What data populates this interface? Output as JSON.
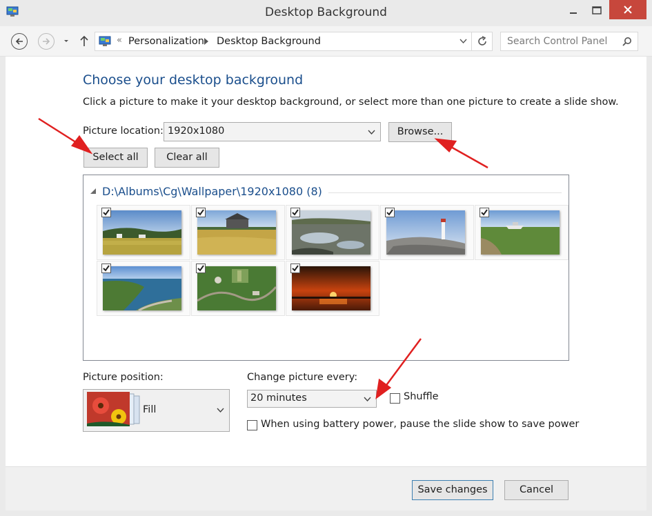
{
  "window": {
    "title": "Desktop Background",
    "icons": {
      "app": "control-panel-icon",
      "minimize": "minimize-icon",
      "maximize": "maximize-icon",
      "close": "close-icon"
    },
    "close_color": "#c7473c"
  },
  "nav": {
    "crumbs": [
      "Personalization",
      "Desktop Background"
    ],
    "search_placeholder": "Search Control Panel"
  },
  "page": {
    "heading": "Choose your desktop background",
    "description": "Click a picture to make it your desktop background, or select more than one picture to create a slide show.",
    "picture_location_label": "Picture location:",
    "picture_location_value": "1920x1080",
    "browse_label": "Browse...",
    "select_all_label": "Select all",
    "clear_all_label": "Clear all",
    "heading_color": "#1a4e8c"
  },
  "gallery": {
    "group_title": "D:\\Albums\\Cg\\Wallpaper\\1920x1080 (8)",
    "thumbnails": [
      {
        "name": "field-with-houses",
        "checked": true
      },
      {
        "name": "barn-in-wheat-field",
        "checked": true
      },
      {
        "name": "rocky-shore-pools",
        "checked": true
      },
      {
        "name": "lighthouse-on-rocks",
        "checked": true
      },
      {
        "name": "boat-on-grassland",
        "checked": true
      },
      {
        "name": "coastal-cliff-road",
        "checked": true
      },
      {
        "name": "aerial-village",
        "checked": true
      },
      {
        "name": "sunset-over-water",
        "checked": true
      }
    ]
  },
  "options": {
    "picture_position_label": "Picture position:",
    "picture_position_value": "Fill",
    "change_every_label": "Change picture every:",
    "change_every_value": "20 minutes",
    "shuffle_label": "Shuffle",
    "shuffle_checked": false,
    "battery_label": "When using battery power, pause the slide show to save power",
    "battery_checked": false
  },
  "footer": {
    "save_label": "Save changes",
    "cancel_label": "Cancel"
  },
  "annotation_color": "#e02020"
}
